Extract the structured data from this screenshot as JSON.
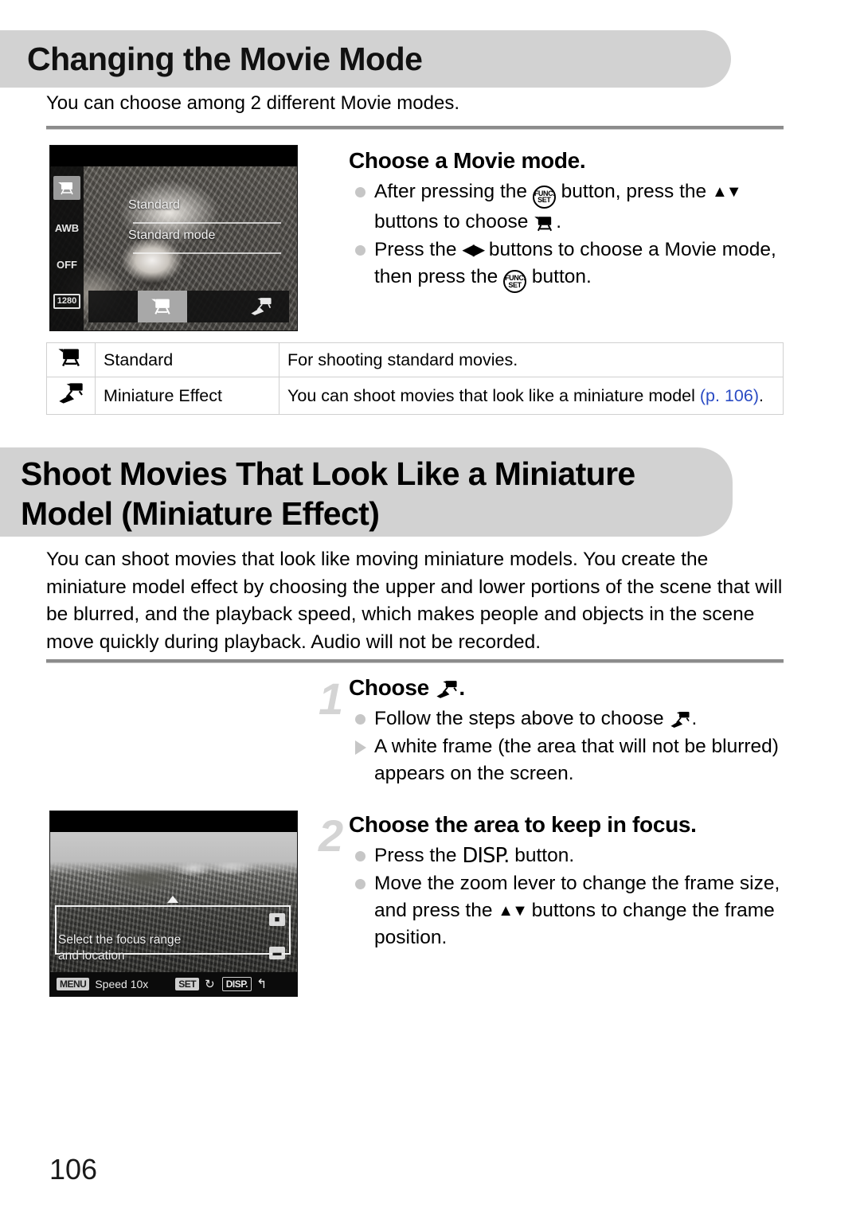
{
  "page": {
    "number": "106"
  },
  "section1": {
    "heading": "Changing the Movie Mode",
    "intro": "You can choose among 2 different Movie modes.",
    "screen": {
      "overlay_title": "Standard",
      "overlay_subtitle": "Standard mode",
      "rail": [
        {
          "name": "movie-mode-icon",
          "label": "",
          "selected": true
        },
        {
          "name": "white-balance-icon",
          "label": "AWB",
          "selected": false
        },
        {
          "name": "flash-off-icon",
          "label": "OFF",
          "selected": false
        },
        {
          "name": "movie-resolution-icon",
          "label": "1280",
          "selected": false
        }
      ],
      "modes": [
        {
          "name": "standard-movie-mode",
          "selected": true
        },
        {
          "name": "miniature-effect-mode",
          "selected": false
        }
      ]
    },
    "instructions": {
      "title": "Choose a Movie mode.",
      "bullets": [
        {
          "marker": "dot",
          "parts": [
            {
              "t": "text",
              "v": "After pressing the "
            },
            {
              "t": "icon",
              "v": "func-set-button-icon"
            },
            {
              "t": "text",
              "v": " button, press the "
            },
            {
              "t": "icon",
              "v": "up-down-buttons-icon"
            },
            {
              "t": "text",
              "v": " buttons to choose "
            },
            {
              "t": "icon",
              "v": "standard-movie-icon"
            },
            {
              "t": "text",
              "v": "."
            }
          ]
        },
        {
          "marker": "dot",
          "parts": [
            {
              "t": "text",
              "v": "Press the "
            },
            {
              "t": "icon",
              "v": "left-right-buttons-icon"
            },
            {
              "t": "text",
              "v": " buttons to choose a Movie mode, then press the "
            },
            {
              "t": "icon",
              "v": "func-set-button-icon"
            },
            {
              "t": "text",
              "v": " button."
            }
          ]
        }
      ]
    },
    "table": {
      "rows": [
        {
          "icon": "standard-movie-icon",
          "name": "Standard",
          "description": "For shooting standard movies.",
          "page_ref": ""
        },
        {
          "icon": "miniature-effect-icon",
          "name": "Miniature Effect",
          "description": "You can shoot movies that look like a miniature model ",
          "page_ref": "(p. 106)",
          "description_tail": "."
        }
      ]
    }
  },
  "section2": {
    "heading_line1": "Shoot Movies That Look Like a Miniature",
    "heading_line2": "Model (Miniature Effect)",
    "body": "You can shoot movies that look like moving miniature models. You create the miniature model effect by choosing the upper and lower portions of the scene that will be blurred, and the playback speed, which makes people and objects in the scene move quickly during playback. Audio will not be recorded.",
    "steps": [
      {
        "number": "1",
        "title_prefix": "Choose ",
        "title_icon": "miniature-effect-icon",
        "title_suffix": ".",
        "bullets": [
          {
            "marker": "dot",
            "parts": [
              {
                "t": "text",
                "v": "Follow the steps above to choose "
              },
              {
                "t": "icon",
                "v": "miniature-effect-icon"
              },
              {
                "t": "text",
                "v": "."
              }
            ]
          },
          {
            "marker": "triangle",
            "parts": [
              {
                "t": "text",
                "v": "A white frame (the area that will not be blurred) appears on the screen."
              }
            ]
          }
        ]
      },
      {
        "number": "2",
        "title": "Choose the area to keep in focus.",
        "bullets": [
          {
            "marker": "dot",
            "parts": [
              {
                "t": "text",
                "v": "Press the "
              },
              {
                "t": "icon",
                "v": "disp-button-icon"
              },
              {
                "t": "text",
                "v": " button."
              }
            ]
          },
          {
            "marker": "dot",
            "parts": [
              {
                "t": "text",
                "v": "Move the zoom lever to change the frame size, and press the "
              },
              {
                "t": "icon",
                "v": "up-down-buttons-icon"
              },
              {
                "t": "text",
                "v": " buttons to change the frame position."
              }
            ]
          }
        ]
      }
    ],
    "screen": {
      "hint_line1": "Select the focus range",
      "hint_line2": "and location",
      "menu_label": "MENU",
      "speed_label": "Speed 10x",
      "set_label": "SET",
      "disp_label": "DISP.",
      "zoom_in_label": "",
      "zoom_out_label": ""
    }
  },
  "icons": {
    "func_set_line1": "FUNC.",
    "func_set_line2": "SET",
    "up_down": "▲▼",
    "left_right": "◀▶",
    "disp": "DISP.",
    "rotate": "↻",
    "return": "↰"
  },
  "colors": {
    "banner_gray": "#d2d2d2",
    "rule_gray": "#8c8c8c",
    "marker_gray": "#c6c6c6",
    "page_ref_blue": "#2b4cc4",
    "step_number_gray": "#d4d4d4"
  }
}
